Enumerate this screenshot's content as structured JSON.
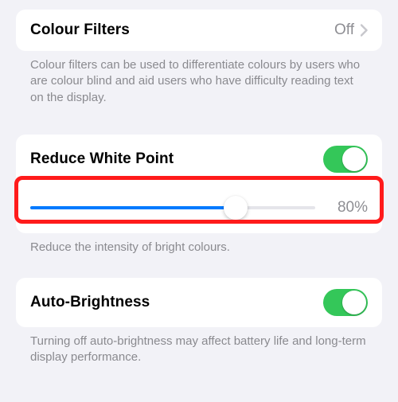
{
  "colour_filters": {
    "label": "Colour Filters",
    "value": "Off",
    "footer": "Colour filters can be used to differentiate colours by users who are colour blind and aid users who have difficulty reading text on the display."
  },
  "reduce_white_point": {
    "label": "Reduce White Point",
    "toggle_on": true,
    "slider_percent": 80,
    "slider_display": "80%",
    "footer": "Reduce the intensity of bright colours."
  },
  "auto_brightness": {
    "label": "Auto-Brightness",
    "toggle_on": true,
    "footer": "Turning off auto-brightness may affect battery life and long-term display performance."
  },
  "colors": {
    "accent_green": "#34c759",
    "accent_blue": "#007aff",
    "highlight_red": "#ff1b1b"
  }
}
